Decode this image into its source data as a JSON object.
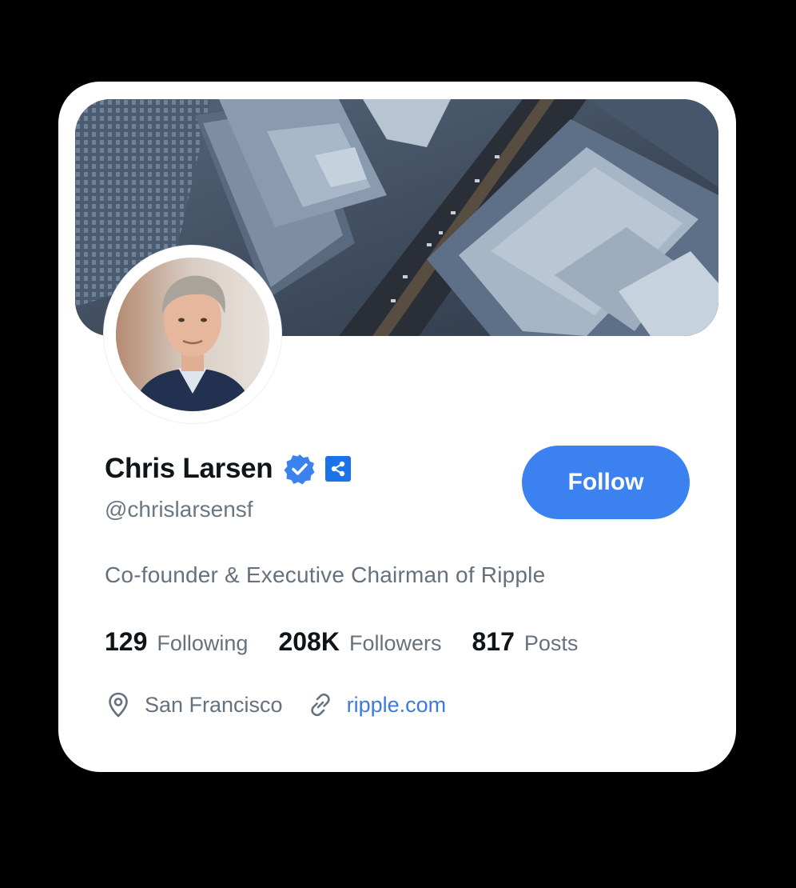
{
  "profile": {
    "name": "Chris Larsen",
    "handle": "@chrislarsensf",
    "bio": "Co-founder & Executive Chairman of Ripple",
    "follow_label": "Follow",
    "verified_icon": "verified-badge-icon",
    "affiliate_icon": "ripple-affiliate-icon"
  },
  "stats": [
    {
      "value": "129",
      "label": "Following"
    },
    {
      "value": "208K",
      "label": "Followers"
    },
    {
      "value": "817",
      "label": "Posts"
    }
  ],
  "meta": {
    "location": "San Francisco",
    "location_icon": "location-pin-icon",
    "website": "ripple.com",
    "website_icon": "link-icon"
  },
  "colors": {
    "accent": "#3b82f0",
    "link": "#3a7be0",
    "text_primary": "#0f1419",
    "text_secondary": "#66717e",
    "background": "#000000",
    "card": "#ffffff"
  }
}
